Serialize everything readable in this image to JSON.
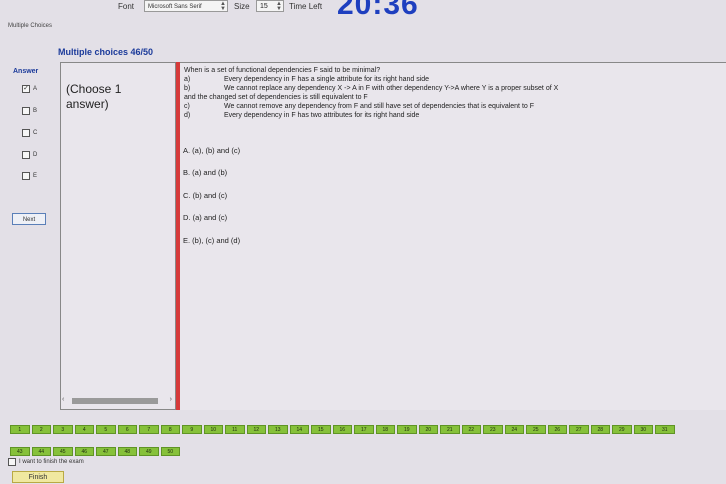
{
  "toolbar": {
    "font_label": "Font",
    "font_value": "Microsoft Sans Serif",
    "size_label": "Size",
    "size_value": "15",
    "time_left_label": "Time Left",
    "timer": "20:36"
  },
  "app_title": "Multiple Choices",
  "question_header": "Multiple choices 46/50",
  "answer_panel": {
    "label": "Answer",
    "options": [
      {
        "letter": "A",
        "checked": true
      },
      {
        "letter": "B",
        "checked": false
      },
      {
        "letter": "C",
        "checked": false
      },
      {
        "letter": "D",
        "checked": false
      },
      {
        "letter": "E",
        "checked": false
      }
    ],
    "next_label": "Next"
  },
  "choose_text": "(Choose 1 answer)",
  "question": {
    "stem": "When is a set of functional dependencies F said to be minimal?",
    "items": [
      {
        "label": "a)",
        "text": "Every dependency in F has a single attribute for its right hand side"
      },
      {
        "label": "b)",
        "text": "We cannot replace any dependency X -> A in F with other dependency Y->A where Y is a proper subset of X"
      },
      {
        "label": "",
        "text": "and the changed set of dependencies is still equivalent to F"
      },
      {
        "label": "c)",
        "text": "We cannot remove any dependency from F and still have set of dependencies that is equivalent to F"
      },
      {
        "label": "d)",
        "text": "Every dependency in F has two attributes for its right hand side"
      }
    ],
    "choices": [
      "A. (a), (b) and (c)",
      "B. (a) and (b)",
      "C. (b) and (c)",
      "D. (a) and (c)",
      "E. (b), (c) and (d)"
    ]
  },
  "question_numbers_row1": [
    "1",
    "2",
    "3",
    "4",
    "5",
    "6",
    "7",
    "8",
    "9",
    "10",
    "11",
    "12",
    "13",
    "14",
    "15",
    "16",
    "17",
    "18",
    "19",
    "20",
    "21",
    "22",
    "23",
    "24",
    "25",
    "26",
    "27",
    "28",
    "29",
    "30",
    "31"
  ],
  "question_numbers_row2": [
    "43",
    "44",
    "45",
    "46",
    "47",
    "48",
    "49",
    "50"
  ],
  "finish": {
    "checkbox_label": "I want to finish the exam",
    "button_label": "Finish"
  },
  "colors": {
    "timer": "#1e3fbf",
    "header": "#1b3a9a",
    "divider": "#d63a3a",
    "nav_button": "#86c13a"
  }
}
